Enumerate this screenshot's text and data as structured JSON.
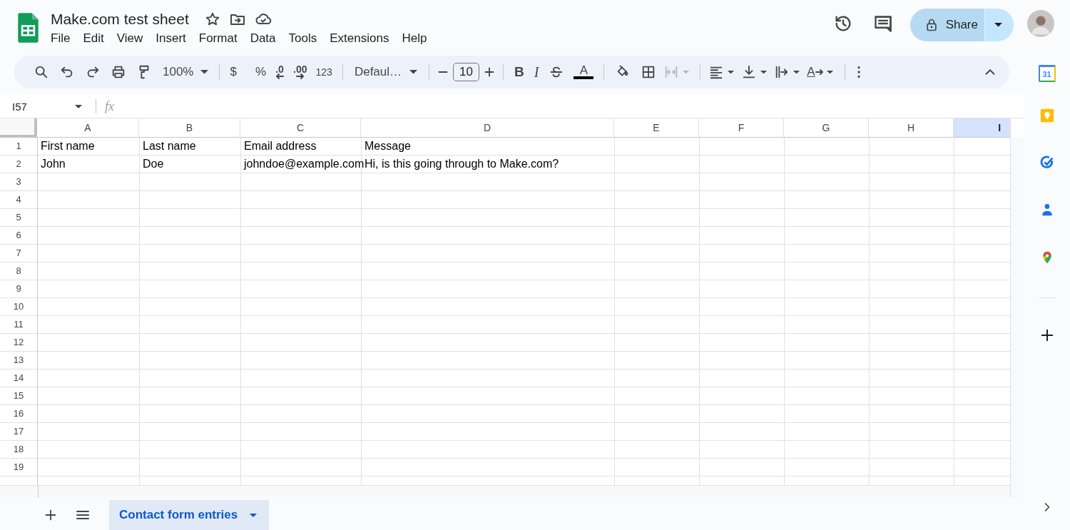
{
  "document": {
    "title": "Make.com test sheet"
  },
  "menu": [
    "File",
    "Edit",
    "View",
    "Insert",
    "Format",
    "Data",
    "Tools",
    "Extensions",
    "Help"
  ],
  "share": {
    "label": "Share"
  },
  "toolbar": {
    "zoom": "100%",
    "currency": "$",
    "percent": "%",
    "decrease_decimal": ".0",
    "increase_decimal": ".00",
    "number_format": "123",
    "font": "Defaul…",
    "font_size": "10",
    "bold": "B",
    "italic": "I",
    "text_color": "A",
    "text_rotation": "A",
    "merge_disabled": true
  },
  "formula_bar": {
    "cell_reference": "I57",
    "function_label": "fx"
  },
  "columns": [
    {
      "label": "A",
      "selected": false
    },
    {
      "label": "B",
      "selected": false
    },
    {
      "label": "C",
      "selected": false
    },
    {
      "label": "D",
      "selected": false
    },
    {
      "label": "E",
      "selected": false
    },
    {
      "label": "F",
      "selected": false
    },
    {
      "label": "G",
      "selected": false
    },
    {
      "label": "H",
      "selected": false
    },
    {
      "label": "I",
      "selected": true
    }
  ],
  "rows": [
    {
      "number": "1",
      "cells": [
        "First name",
        "Last name",
        "Email address",
        "Message"
      ]
    },
    {
      "number": "2",
      "cells": [
        "John",
        "Doe",
        "johndoe@example.com",
        "Hi, is this going through to Make.com?"
      ]
    },
    {
      "number": "3"
    },
    {
      "number": "4"
    },
    {
      "number": "5"
    },
    {
      "number": "6"
    },
    {
      "number": "7"
    },
    {
      "number": "8"
    },
    {
      "number": "9"
    },
    {
      "number": "10"
    },
    {
      "number": "11"
    },
    {
      "number": "12"
    },
    {
      "number": "13"
    },
    {
      "number": "14"
    },
    {
      "number": "15"
    },
    {
      "number": "16"
    },
    {
      "number": "17"
    },
    {
      "number": "18"
    },
    {
      "number": "19"
    }
  ],
  "sheets": [
    {
      "name": "Contact form entries",
      "selected": true
    }
  ],
  "side_panel": {
    "calendar_day": "31"
  }
}
